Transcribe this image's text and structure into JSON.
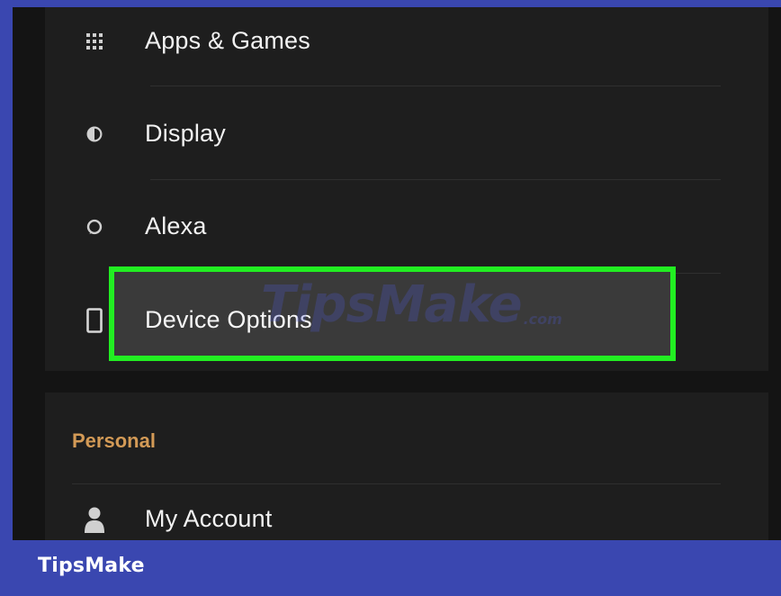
{
  "menu": {
    "items": [
      {
        "label": "Apps & Games",
        "icon": "apps-grid-icon"
      },
      {
        "label": "Display",
        "icon": "display-brightness-icon"
      },
      {
        "label": "Alexa",
        "icon": "alexa-ring-icon"
      },
      {
        "label": "Device Options",
        "icon": "device-tablet-icon",
        "highlighted": true
      }
    ]
  },
  "personal": {
    "title": "Personal",
    "items": [
      {
        "label": "My Account",
        "icon": "person-icon"
      }
    ]
  },
  "watermark": {
    "main": "TipsMake",
    "sub": ".com"
  },
  "footer": {
    "brand": "TipsMake"
  },
  "colors": {
    "frame": "#3a47b0",
    "background": "#141414",
    "card": "#1e1e1e",
    "highlight_border": "#22ee22",
    "section_accent": "#d39a56",
    "text": "#f2f2f2"
  }
}
